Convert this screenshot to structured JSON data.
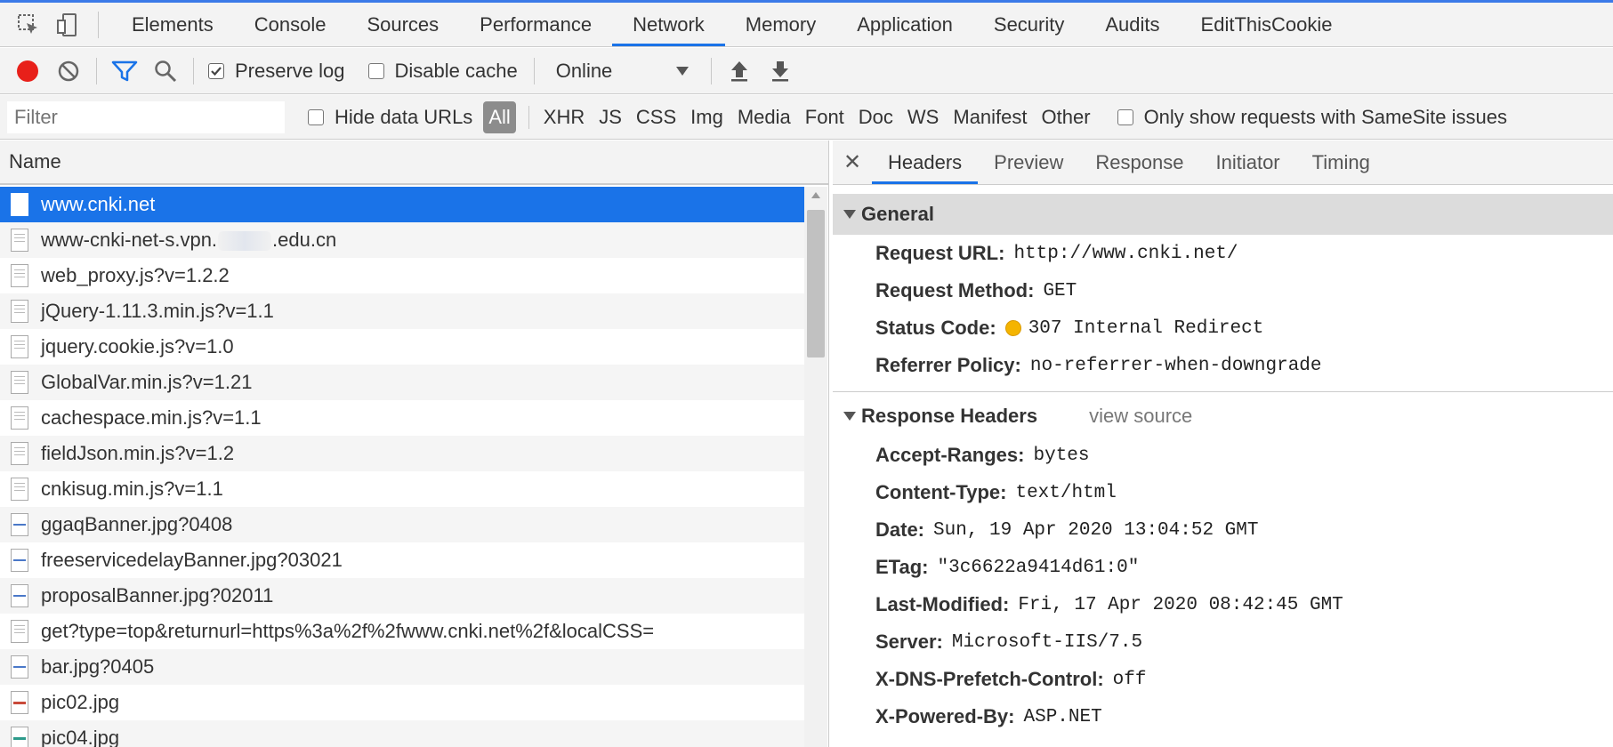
{
  "main_tabs": [
    "Elements",
    "Console",
    "Sources",
    "Performance",
    "Network",
    "Memory",
    "Application",
    "Security",
    "Audits",
    "EditThisCookie"
  ],
  "active_main_tab": "Network",
  "toolbar": {
    "preserve_log": "Preserve log",
    "preserve_log_checked": true,
    "disable_cache": "Disable cache",
    "disable_cache_checked": false,
    "throttling": "Online"
  },
  "filter": {
    "placeholder": "Filter",
    "hide_data_urls": "Hide data URLs",
    "types": [
      "All",
      "XHR",
      "JS",
      "CSS",
      "Img",
      "Media",
      "Font",
      "Doc",
      "WS",
      "Manifest",
      "Other"
    ],
    "active_type": "All",
    "samesite": "Only show requests with SameSite issues"
  },
  "requests": {
    "header": "Name",
    "rows": [
      {
        "name": "www.cnki.net",
        "icon": "document-icon"
      },
      {
        "name_pre": "www-cnki-net-s.vpn.",
        "name_post": ".edu.cn",
        "icon": "document-icon"
      },
      {
        "name": "web_proxy.js?v=1.2.2",
        "icon": "script-icon"
      },
      {
        "name": "jQuery-1.11.3.min.js?v=1.1",
        "icon": "script-icon"
      },
      {
        "name": "jquery.cookie.js?v=1.0",
        "icon": "script-icon"
      },
      {
        "name": "GlobalVar.min.js?v=1.21",
        "icon": "script-icon"
      },
      {
        "name": "cachespace.min.js?v=1.1",
        "icon": "script-icon"
      },
      {
        "name": "fieldJson.min.js?v=1.2",
        "icon": "script-icon"
      },
      {
        "name": "cnkisug.min.js?v=1.1",
        "icon": "script-icon"
      },
      {
        "name": "ggaqBanner.jpg?0408",
        "icon": "image-icon"
      },
      {
        "name": "freeservicedelayBanner.jpg?03021",
        "icon": "image-icon"
      },
      {
        "name": "proposalBanner.jpg?02011",
        "icon": "image-icon"
      },
      {
        "name": "get?type=top&returnurl=https%3a%2f%2fwww.cnki.net%2f&localCSS=",
        "icon": "script-icon"
      },
      {
        "name": "bar.jpg?0405",
        "icon": "image-icon"
      },
      {
        "name": "pic02.jpg",
        "icon": "image-icon"
      },
      {
        "name": "pic04.jpg",
        "icon": "image-icon"
      }
    ]
  },
  "detail_tabs": [
    "Headers",
    "Preview",
    "Response",
    "Initiator",
    "Timing"
  ],
  "active_detail_tab": "Headers",
  "general": {
    "title": "General",
    "request_url_k": "Request URL:",
    "request_url_v": "http://www.cnki.net/",
    "request_method_k": "Request Method:",
    "request_method_v": "GET",
    "status_code_k": "Status Code:",
    "status_code_v": "307 Internal Redirect",
    "referrer_policy_k": "Referrer Policy:",
    "referrer_policy_v": "no-referrer-when-downgrade"
  },
  "response_headers": {
    "title": "Response Headers",
    "view_source": "view source",
    "items": [
      {
        "k": "Accept-Ranges:",
        "v": "bytes"
      },
      {
        "k": "Content-Type:",
        "v": "text/html"
      },
      {
        "k": "Date:",
        "v": "Sun, 19 Apr 2020 13:04:52 GMT"
      },
      {
        "k": "ETag:",
        "v": "\"3c6622a9414d61:0\""
      },
      {
        "k": "Last-Modified:",
        "v": "Fri, 17 Apr 2020 08:42:45 GMT"
      },
      {
        "k": "Server:",
        "v": "Microsoft-IIS/7.5"
      },
      {
        "k": "X-DNS-Prefetch-Control:",
        "v": "off"
      },
      {
        "k": "X-Powered-By:",
        "v": "ASP.NET"
      }
    ]
  },
  "colors": {
    "accent": "#1a73e8",
    "record": "#e8201a",
    "status_warning": "#f4b400"
  }
}
